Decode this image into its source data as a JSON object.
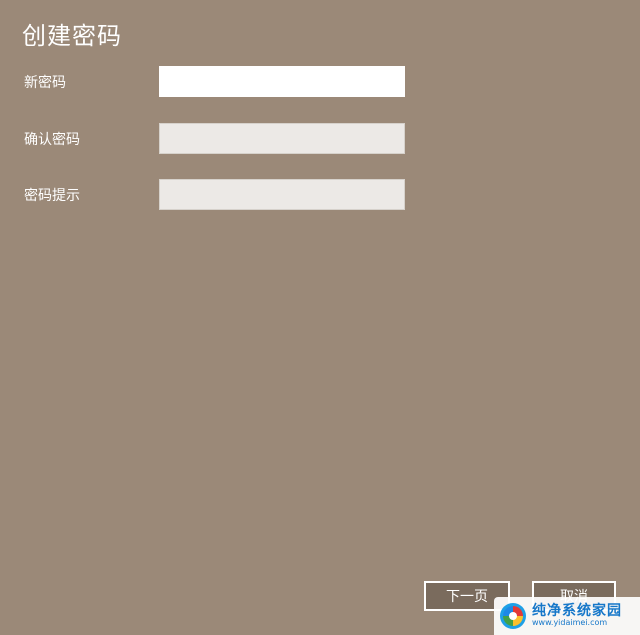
{
  "dialog": {
    "title": "创建密码"
  },
  "form": {
    "new_password_label": "新密码",
    "confirm_password_label": "确认密码",
    "hint_label": "密码提示",
    "new_password_value": "",
    "confirm_password_value": "",
    "hint_value": ""
  },
  "buttons": {
    "next_label": "下一页",
    "cancel_label": "取消"
  },
  "watermark": {
    "name": "纯净系统家园",
    "url": "www.yidaimei.com"
  }
}
